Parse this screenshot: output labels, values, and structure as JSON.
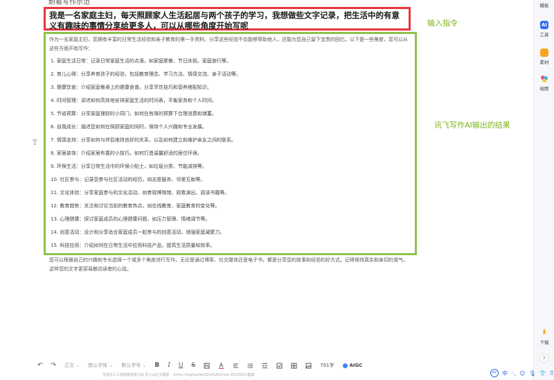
{
  "top_cut_text": "耐看写作示范",
  "prompt": "我是一名家庭主妇，每天照顾家人生活起居与两个孩子的学习，我想做些文字记录，把生活中的有意义有趣味的事情分享给更多人，可以从哪些角度开始写呢",
  "labels": {
    "input": "输入指令",
    "output": "讯飞写作AI输出的结果"
  },
  "output": {
    "intro": "作为一名家庭主妇，您拥有丰富的日常生活经验和亲子教育的第一手资料。分享这些经验不仅能够帮助他人，还能为您自己留下宝贵的回忆。以下是一些角度，您可以从这些方面开始写作：",
    "items": [
      "1. 家庭生活日常：记录日常家庭生活的点滴，如家庭聚餐、节日庆祝、家庭旅行等。",
      "2. 育儿心得：分享养育孩子的经验，包括教育理念、学习方法、情感交流、亲子活动等。",
      "3. 健康饮食：介绍家庭餐桌上的健康食谱，分享烹饪技巧和营养搭配知识。",
      "4. 时间管理：讲述如何高效地安排家庭生活的时间表，平衡家务和个人时间。",
      "5. 节省预算：分享家庭理财的小窍门，如何在有限的预算下合理消费和储蓄。",
      "6. 自我成长：描述您如何在照顾家庭的同时，保持个人兴趣和专业发展。",
      "7. 情感支持：分享如何与伴侣维持良好的关系，以及如何建立和维护亲友之间的联系。",
      "8. 家居装饰：介绍家居布置的小技巧，如何打造温馨舒适的居住环境。",
      "9. 环保生活：分享日常生活中的环保小贴士，如垃圾分类、节能减排等。",
      "10. 社区参与：记录您参与社区活动的经历，如志愿服务、邻里互助等。",
      "11. 文化体验：分享家庭参与的文化活动，如参观博物馆、观看演出、阅读书籍等。",
      "12. 教育趋势：关注和讨论当前的教育热点，如在线教育、家庭教育的变化等。",
      "13. 心理健康：探讨家庭成员的心理健康问题，如压力管理、情绪调节等。",
      "14. 创意活动：设计和分享适合家庭成员一起参与的创意活动，增强家庭凝聚力。",
      "15. 科技应用：介绍如何在日常生活中应用科技产品，提高生活质量和效率。"
    ],
    "outro": "您可以根据自己的兴趣和专长选择一个或多个角度进行写作。无论是通过博客、社交媒体还是电子书，都是分享您的故事和经验的好方式。记得保持真实和亲切的语气，这样您的文字更容易触动读者的心弦。"
  },
  "sidebar": {
    "items": [
      {
        "label": "模板",
        "icon": "template-icon"
      },
      {
        "label": "工具",
        "icon": "ai-icon"
      },
      {
        "label": "素材",
        "icon": "folder-icon"
      },
      {
        "label": "绘图",
        "icon": "palette-icon"
      },
      {
        "label": "下载",
        "icon": "download-icon"
      }
    ],
    "help_label": "?"
  },
  "toolbar": {
    "undo": "↶",
    "redo": "↷",
    "para_style": "正文",
    "font_family": "默认字体",
    "font_size": "默认字号",
    "bold": "B",
    "italic": "I",
    "underline": "U",
    "strike": "S",
    "word_count": "791字",
    "aigc": "AIGC"
  },
  "footer_note": "生成式人工智能服务能力由 爱火山社大模型 – Anhui-XingHuoRenZhiDaMoXing-20230823备案",
  "tray": {
    "ime_lang": "中"
  },
  "colors": {
    "prompt_border": "#e8343c",
    "output_border": "#8bc34a",
    "label_green": "#7bb31a",
    "ai_blue": "#2f6cf6"
  }
}
